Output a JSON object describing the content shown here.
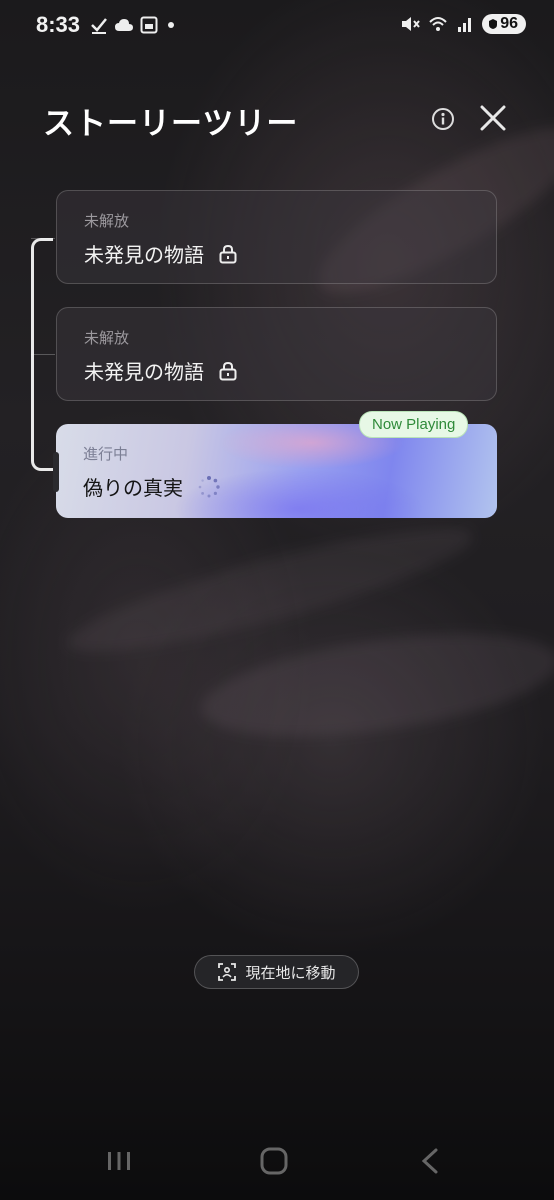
{
  "status_bar": {
    "time": "8:33",
    "battery": "96",
    "left_icons": [
      "check-icon",
      "cloud-icon",
      "image-icon",
      "dot-icon"
    ],
    "right_icons": [
      "mute-icon",
      "wifi-icon",
      "signal-icon",
      "battery-icon"
    ]
  },
  "header": {
    "title": "ストーリーツリー"
  },
  "stories": [
    {
      "status": "未解放",
      "title": "未発見の物語",
      "icon": "lock-icon"
    },
    {
      "status": "未解放",
      "title": "未発見の物語",
      "icon": "lock-icon"
    },
    {
      "status": "進行中",
      "title": "偽りの真実",
      "icon": "loading-spinner-icon",
      "badge": "Now Playing"
    }
  ],
  "move_button": {
    "label": "現在地に移動",
    "icon": "focus-target-icon"
  },
  "nav_bar": [
    "recents-icon",
    "home-icon",
    "back-icon"
  ],
  "colors": {
    "badge_text": "#2f8a3a",
    "badge_bg": "#e7f8e6",
    "active_gradient_start": "#d8dce8",
    "active_gradient_end": "#7f86ee"
  }
}
